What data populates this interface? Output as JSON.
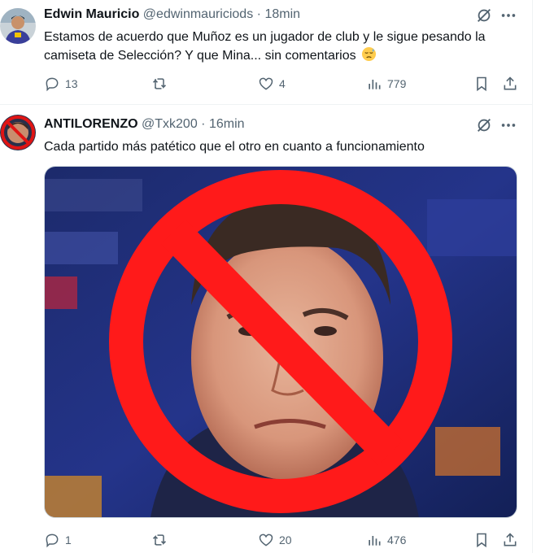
{
  "tweets": [
    {
      "author_name": "Edwin Mauricio",
      "handle": "@edwinmauriciods",
      "separator": "·",
      "time": "18min",
      "text": "Estamos de acuerdo que Muñoz es un jugador de club y le sigue pesando la camiseta de Selección? Y que Mina... sin comentarios",
      "emoji": "downcast-face-with-sweat",
      "replies": "13",
      "retweets": "",
      "likes": "4",
      "views": "779"
    },
    {
      "author_name": "ANTILORENZO",
      "handle": "@Txk200",
      "separator": "·",
      "time": "16min",
      "text": "Cada partido más patético que el otro en cuanto a funcionamiento",
      "media": "photo-of-man-with-red-prohibition-sign",
      "replies": "1",
      "retweets": "",
      "likes": "20",
      "views": "476"
    }
  ],
  "colors": {
    "text_primary": "#0f1419",
    "text_secondary": "#536471",
    "divider": "#eff3f4",
    "prohibition_red": "#ff1a1a"
  },
  "icons": [
    "grok-icon",
    "more-icon",
    "reply-icon",
    "retweet-icon",
    "like-icon",
    "views-icon",
    "bookmark-icon",
    "share-icon"
  ]
}
